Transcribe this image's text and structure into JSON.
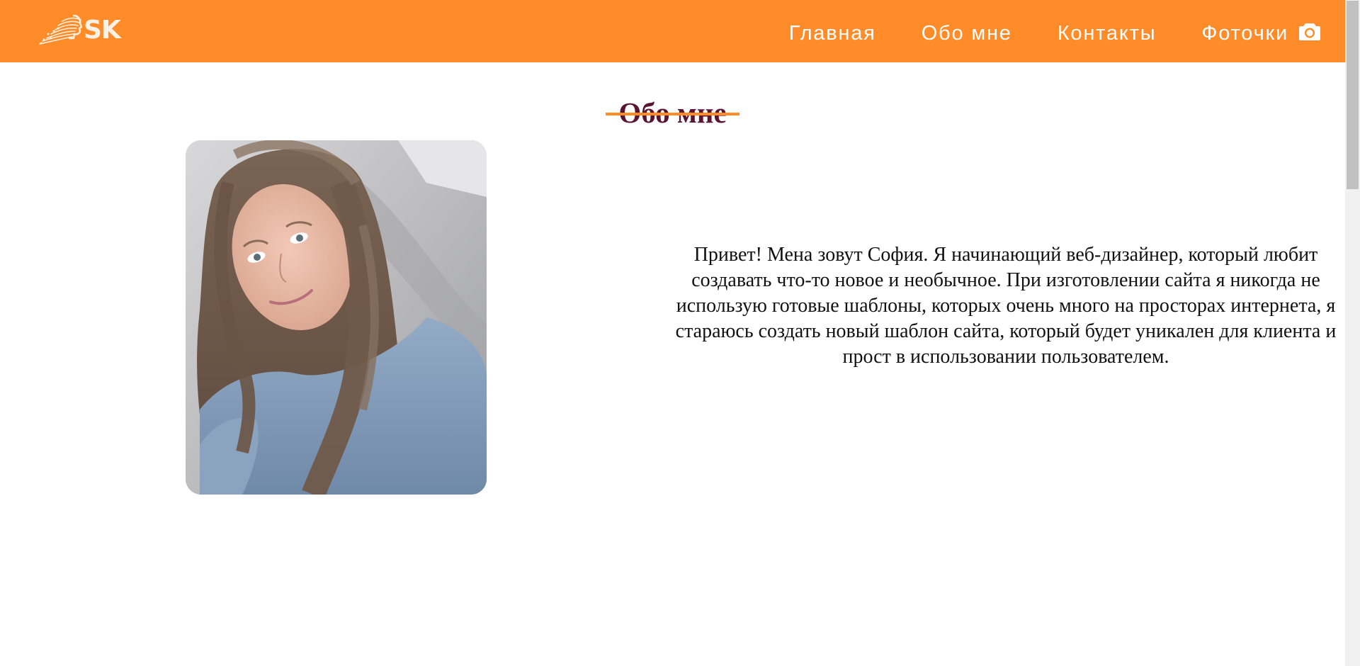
{
  "header": {
    "logo_text": "SK",
    "nav": [
      {
        "label": "Главная"
      },
      {
        "label": "Обо мне"
      },
      {
        "label": "Контакты"
      },
      {
        "label": "Фоточки",
        "icon": "camera-icon"
      }
    ],
    "background_color": "#FF8C28"
  },
  "main": {
    "title": "Обо мне",
    "title_color": "#5A1532",
    "accent_color": "#FF8C28",
    "about_text": "Привет! Мена зовут София. Я начинающий веб-дизайнер, который любит создавать что-то новое и необычное. При изготовлении сайта я никогда не использую готовые шаблоны, которых очень много на просторах интернета, я стараюсь создать новый шаблон сайта, который будет уникален для клиента и прост в использовании пользователем."
  }
}
